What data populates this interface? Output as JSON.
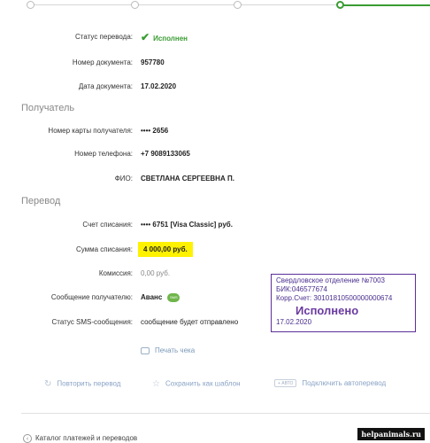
{
  "stepper": {
    "steps": [
      "",
      "",
      "",
      ""
    ],
    "active_index": 3
  },
  "details": {
    "status_label": "Статус перевода:",
    "status_value": "Исполнен",
    "doc_num_label": "Номер документа:",
    "doc_num_value": "957780",
    "doc_date_label": "Дата документа:",
    "doc_date_value": "17.02.2020"
  },
  "recipient": {
    "header": "Получатель",
    "card_label": "Номер карты получателя:",
    "card_value": "•••• 2656",
    "phone_label": "Номер телефона:",
    "phone_value": "+7 9089133065",
    "name_label": "ФИО:",
    "name_value": "СВЕТЛАНА СЕРГЕЕВНА П."
  },
  "transfer": {
    "header": "Перевод",
    "account_label": "Счет списания:",
    "account_value": "•••• 6751  [Visa Classic]  руб.",
    "amount_label": "Сумма списания:",
    "amount_value": "4 000,00  руб.",
    "commission_label": "Комиссия:",
    "commission_value": "0,00 руб.",
    "message_label": "Сообщение получателю:",
    "message_value": "Аванс",
    "sms_badge": "SMS",
    "sms_status_label": "Статус SMS-сообщения:",
    "sms_status_value": "сообщение будет отправлено"
  },
  "stamp": {
    "line1": "Свердловское отделение №7003",
    "line2": "БИК:046577674",
    "line3": "Корр.Счет: 30101810500000000674",
    "big": "Исполнено",
    "date": "17.02.2020"
  },
  "actions": {
    "print": "Печать чека",
    "repeat": "Повторить перевод",
    "save_template": "Сохранить как шаблон",
    "auto_chip": "+ АВТО",
    "autopay": "Подключить автоперевод"
  },
  "footer": {
    "catalog": "Каталог платежей и переводов"
  },
  "watermark": "helpanimals.ru",
  "colors": {
    "accent_green": "#3a9c33",
    "highlight_yellow": "#fff200",
    "link_blue": "#8aa3c6",
    "stamp_purple": "#5a2f9a"
  }
}
